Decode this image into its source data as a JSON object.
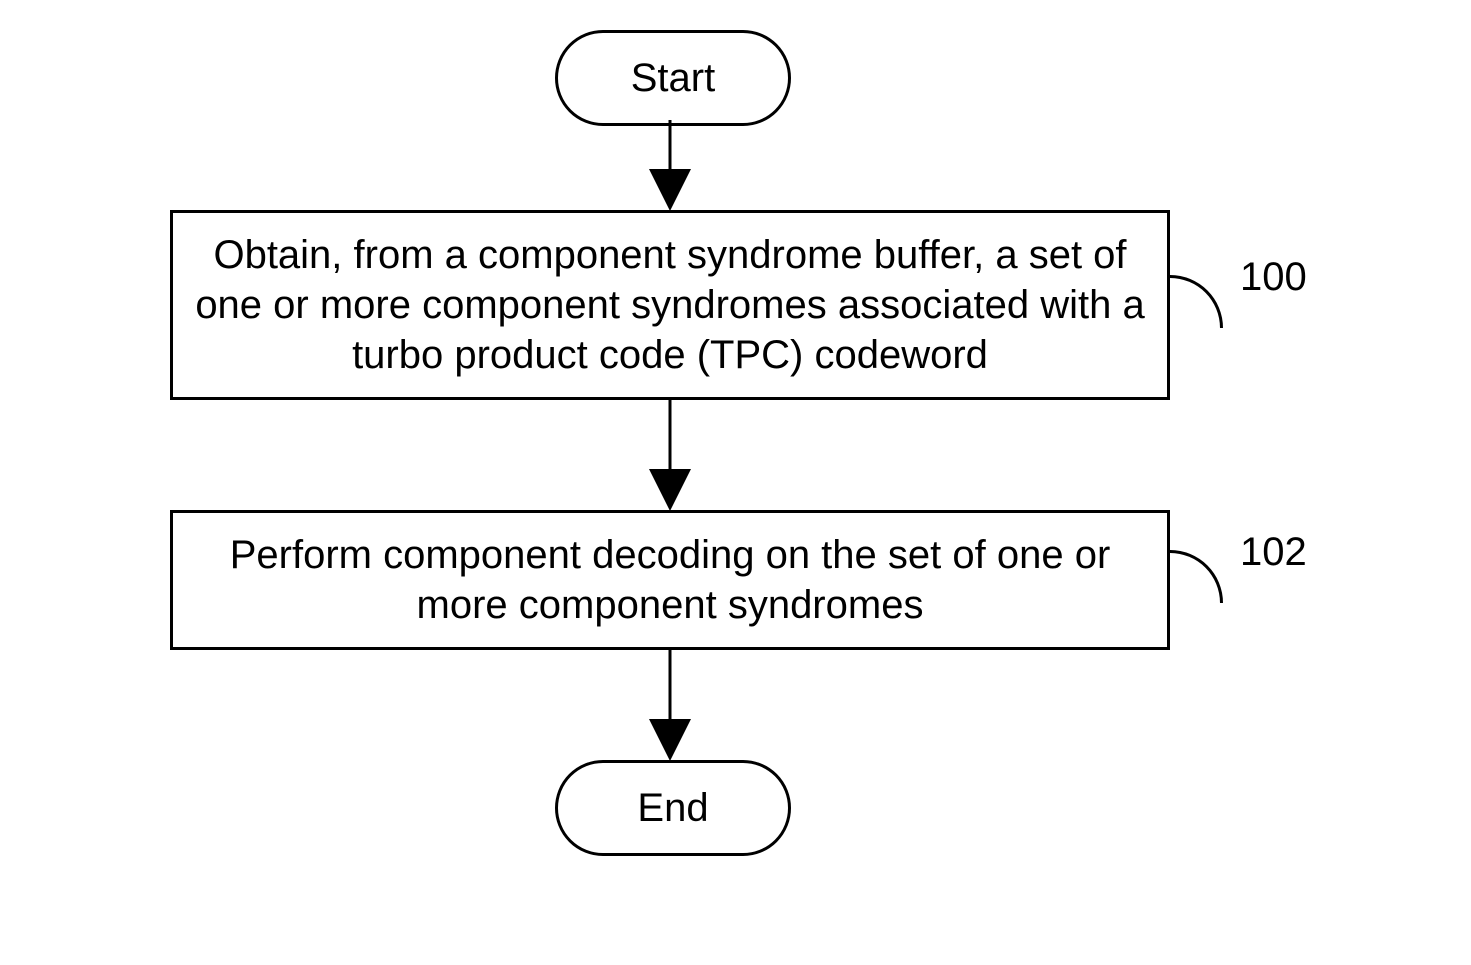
{
  "flow": {
    "start": "Start",
    "end": "End",
    "step1": "Obtain, from a component syndrome buffer, a set of one or more component syndromes associated with a turbo product code (TPC) codeword",
    "step2": "Perform component decoding on the set of one or more component syndromes",
    "ref1": "100",
    "ref2": "102"
  }
}
